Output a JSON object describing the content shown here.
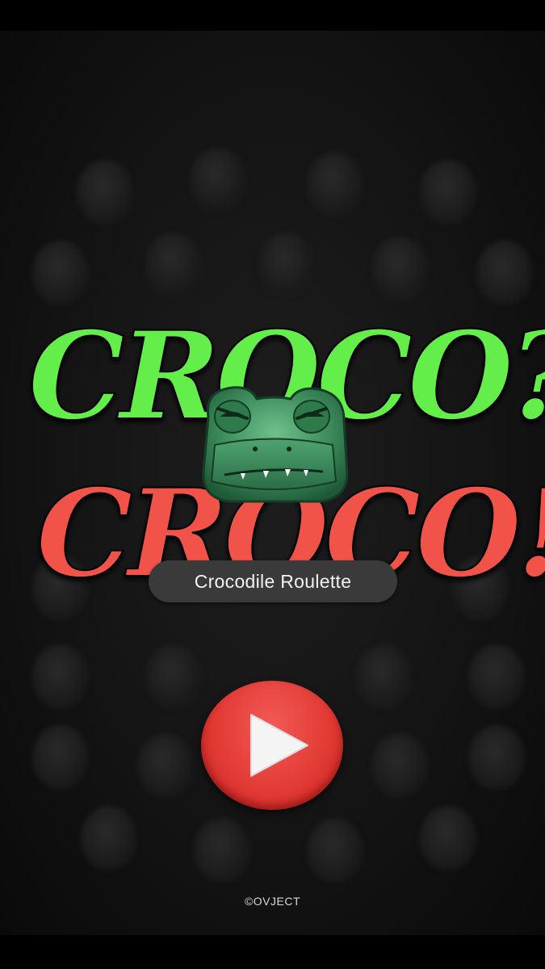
{
  "game": {
    "title_line1": "CROCO?",
    "title_line2": "CROCO!",
    "subtitle": "Crocodile Roulette",
    "copyright": "©OVJECT"
  },
  "colors": {
    "green": "#63ee4a",
    "red": "#f2534a",
    "button_red": "#e33b36",
    "croc_green": "#3f8f5e"
  },
  "icons": {
    "play": "play-icon",
    "mascot": "crocodile-head-icon"
  }
}
